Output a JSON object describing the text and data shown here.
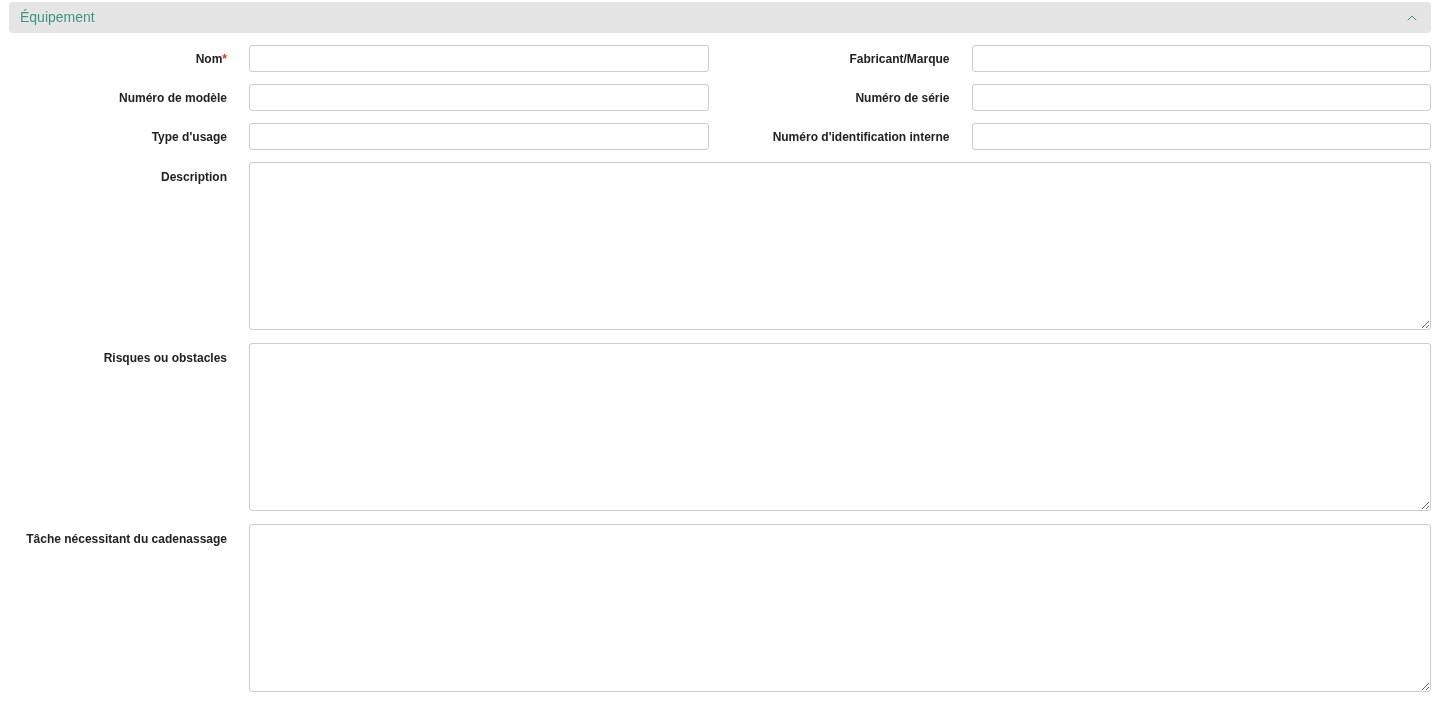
{
  "section": {
    "title": "Équipement",
    "expanded": true
  },
  "field_rows": [
    [
      {
        "label": "Nom",
        "required_mark": "*"
      },
      {
        "label": "Fabricant/Marque"
      }
    ],
    [
      {
        "label": "Numéro de modèle"
      },
      {
        "label": "Numéro de série"
      }
    ],
    [
      {
        "label": "Type d'usage"
      },
      {
        "label": "Numéro d'identification interne"
      }
    ]
  ],
  "text_areas": [
    {
      "label": "Description"
    },
    {
      "label": "Risques ou obstacles"
    },
    {
      "label": "Tâche nécessitant du cadenassage"
    }
  ]
}
